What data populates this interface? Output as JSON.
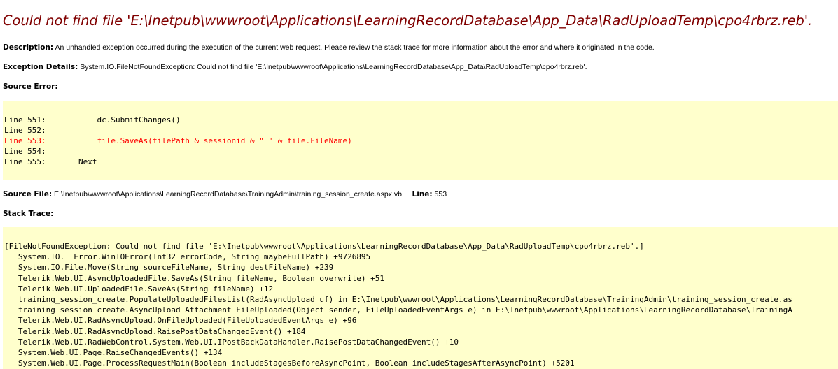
{
  "title": "Could not find file 'E:\\Inetpub\\wwwroot\\Applications\\LearningRecordDatabase\\App_Data\\RadUploadTemp\\cpo4rbrz.reb'.",
  "description": {
    "label": "Description:",
    "text": "An unhandled exception occurred during the execution of the current web request. Please review the stack trace for more information about the error and where it originated in the code."
  },
  "exception_details": {
    "label": "Exception Details:",
    "text": "System.IO.FileNotFoundException: Could not find file 'E:\\Inetpub\\wwwroot\\Applications\\LearningRecordDatabase\\App_Data\\RadUploadTemp\\cpo4rbrz.reb'."
  },
  "source_error": {
    "label": "Source Error:",
    "lines": [
      {
        "text": "Line 551:           dc.SubmitChanges()",
        "error": false
      },
      {
        "text": "Line 552:",
        "error": false
      },
      {
        "text": "Line 553:           file.SaveAs(filePath & sessionid & \"_\" & file.FileName)",
        "error": true
      },
      {
        "text": "Line 554:",
        "error": false
      },
      {
        "text": "Line 555:       Next",
        "error": false
      }
    ]
  },
  "source_file": {
    "label": "Source File:",
    "path": "E:\\Inetpub\\wwwroot\\Applications\\LearningRecordDatabase\\TrainingAdmin\\training_session_create.aspx.vb",
    "line_label": "Line:",
    "line_number": "553"
  },
  "stack_trace": {
    "label": "Stack Trace:",
    "lines": [
      "[FileNotFoundException: Could not find file 'E:\\Inetpub\\wwwroot\\Applications\\LearningRecordDatabase\\App_Data\\RadUploadTemp\\cpo4rbrz.reb'.]",
      "   System.IO.__Error.WinIOError(Int32 errorCode, String maybeFullPath) +9726895",
      "   System.IO.File.Move(String sourceFileName, String destFileName) +239",
      "   Telerik.Web.UI.AsyncUploadedFile.SaveAs(String fileName, Boolean overwrite) +51",
      "   Telerik.Web.UI.UploadedFile.SaveAs(String fileName) +12",
      "   training_session_create.PopulateUploadedFilesList(RadAsyncUpload uf) in E:\\Inetpub\\wwwroot\\Applications\\LearningRecordDatabase\\TrainingAdmin\\training_session_create.as",
      "   training_session_create.AsyncUpload_Attachment_FileUploaded(Object sender, FileUploadedEventArgs e) in E:\\Inetpub\\wwwroot\\Applications\\LearningRecordDatabase\\TrainingA",
      "   Telerik.Web.UI.RadAsyncUpload.OnFileUploaded(FileUploadedEventArgs e) +96",
      "   Telerik.Web.UI.RadAsyncUpload.RaisePostDataChangedEvent() +184",
      "   Telerik.Web.UI.RadWebControl.System.Web.UI.IPostBackDataHandler.RaisePostDataChangedEvent() +10",
      "   System.Web.UI.Page.RaiseChangedEvents() +134",
      "   System.Web.UI.Page.ProcessRequestMain(Boolean includeStagesBeforeAsyncPoint, Boolean includeStagesAfterAsyncPoint) +5201"
    ]
  }
}
